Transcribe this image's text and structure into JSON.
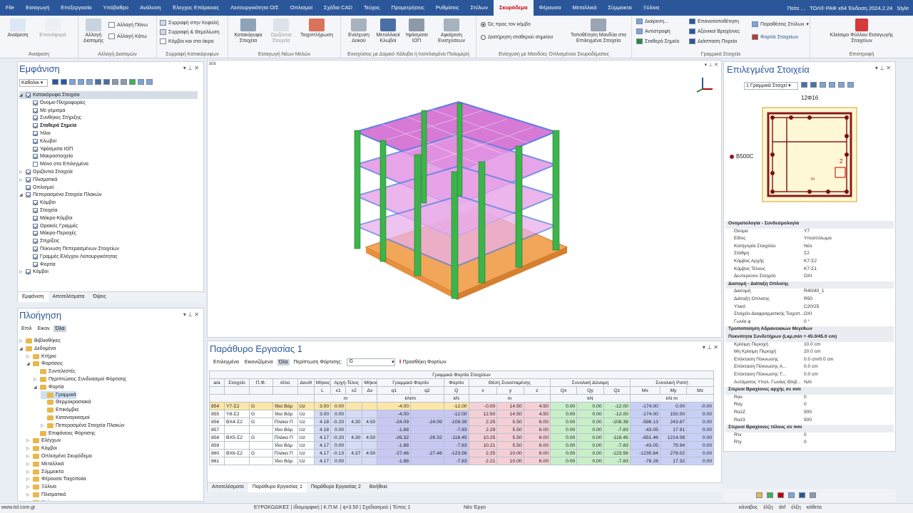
{
  "app": {
    "title": "ΤΟΛ® ΡΑΦ x64 Έκδοση 2024.2.24",
    "style_label": "Style",
    "search": "Πείτε ...",
    "colors": {
      "accent": "#2b579a",
      "active_tab": "#c00000"
    }
  },
  "ribbon_tabs": [
    "File",
    "Εισαγωγή",
    "Επεξεργασία",
    "Υπόβαθρο",
    "Ανάλυση",
    "Έλεγχος Επάρκειας",
    "Λειτουργικότητα Ο/Σ",
    "Οπλισμοί",
    "Σχέδια CAD",
    "Τεύχος",
    "Προμετρήσεις",
    "Ρυθμίσεις",
    "Στύλων",
    "Σκυρόδεμα",
    "Φέρουσα",
    "Μεταλλικά",
    "Σύμμεικτα",
    "Ξύλινα"
  ],
  "active_tab": "Σκυρόδεμα",
  "ribbon": {
    "g1": {
      "label": "Αναίρεση",
      "b1": "Αναίρεση",
      "b2": "Επανάφορά"
    },
    "g2": {
      "label": "Αλλαγή Διατομών",
      "b1": "Αλλαγή Διατομής",
      "s1": "Αλλαγή Πάνω",
      "s2": "Αλλαγή Κάτω"
    },
    "g3": {
      "label": "Συρραφή Κατακόρυφων",
      "s1": "Συρραφή στην Κεφαλή",
      "s2": "Συρραφή & Θεμελίωση",
      "s3": "Κόμβοι και στα άκρα"
    },
    "g4": {
      "label": "Εισαγωγή Νέων Μελών",
      "b1": "Κατακόρυφα Στοιχεία",
      "b2": "Οριζόντια Στοιχεία",
      "b3": "Τοιχοπλήρωση"
    },
    "g5": {
      "label": "Ενισχύσεις με Δομικό Χάλυβα ή Ινοπλισμένα Πολυμερή",
      "b1": "Ενίσχυση Δοκού",
      "b2": "Μεταλλικοί Κλωβοί",
      "b3": "Υφάσματα ΙΟΠ",
      "b4": "Αφαίρεση Ενισχύσεων"
    },
    "g6": {
      "label": "Ενίσχυση με Μανδύες Οπλισμένου Σκυροδέματος",
      "r1": "Ώς προς τον κόμβο",
      "r2": "Διατήρηση σταθερού σημείου",
      "b1": "Τοποθέτηση Μανδύα στα Επιλεγμένα Στοιχεία"
    },
    "g7": {
      "label": "Γραμμικά Στοιχεία",
      "s1": "Διαίρεση...",
      "s2": "Αντιστροφή",
      "s3": "Σταθερό Σημείο",
      "s4": "Επανατοποθέτηση",
      "s5": "Αξονικοί Βραχίονες",
      "s6": "Διάσπαση Πορεία",
      "s7": "Παραθέσεις Στύλων",
      "s8": "Φορτία Στοιχείων"
    },
    "g8": {
      "label": "Επιστροφή",
      "b1": "Κλείσιμο Φύλλου Εισαγωγής Στοιχείων"
    }
  },
  "left_top": {
    "title": "Εμφάνιση",
    "filter": "Καθολικ",
    "items": [
      {
        "label": "Κατακόρυφα Στοιχεία",
        "lvl": 0,
        "tri": "◢",
        "hl": true
      },
      {
        "label": "Όνομα-Πληροφορίες",
        "lvl": 1
      },
      {
        "label": "Με γέμισμα",
        "lvl": 1
      },
      {
        "label": "Συνθήκες Στήριξης",
        "lvl": 1
      },
      {
        "label": "Σταθερά Σημεία",
        "lvl": 1,
        "bold": true
      },
      {
        "label": "Ήλοι",
        "lvl": 1
      },
      {
        "label": "Κλωβοί",
        "lvl": 1
      },
      {
        "label": "Υφάσματα ΙΟΠ",
        "lvl": 1
      },
      {
        "label": "Μακροστοιχεία",
        "lvl": 1
      },
      {
        "label": "Μόνο στα Επιλεγμένα",
        "lvl": 1,
        "nochk": true
      },
      {
        "label": "Οριζόντια Στοιχεία",
        "lvl": 0,
        "tri": "▷"
      },
      {
        "label": "Πλισματικά",
        "lvl": 0,
        "tri": "▷"
      },
      {
        "label": "Οπλισμοί",
        "lvl": 0
      },
      {
        "label": "Πεπερασμένα Στοιχεία Πλακών",
        "lvl": 0,
        "tri": "◢"
      },
      {
        "label": "Κόμβοι",
        "lvl": 1
      },
      {
        "label": "Στοιχεία",
        "lvl": 1
      },
      {
        "label": "Μάκρο-Κόμβοι",
        "lvl": 1
      },
      {
        "label": "Οριακές Γραμμές",
        "lvl": 1
      },
      {
        "label": "Μάκρο-Περιοχές",
        "lvl": 1
      },
      {
        "label": "Στηρίξεις",
        "lvl": 1
      },
      {
        "label": "Πύκνωση Πεπερασμένων Στοιχείων",
        "lvl": 1
      },
      {
        "label": "Γραμμές Ελέγχου Λειτουργικότητας",
        "lvl": 1
      },
      {
        "label": "Φορτία",
        "lvl": 1
      },
      {
        "label": "Κόμβοι",
        "lvl": 0,
        "tri": "▷"
      }
    ],
    "tabs": [
      "Εμφάνιση",
      "Αποτελέσματα",
      "Όψεις"
    ]
  },
  "left_bottom": {
    "title": "Πλοήγηση",
    "filters": [
      "Επιλ",
      "Εικον",
      "Όλα"
    ],
    "items": [
      {
        "label": "Βιβλιοθήκες",
        "lvl": 0,
        "tri": "▷"
      },
      {
        "label": "Δεδομένα",
        "lvl": 0,
        "tri": "◢"
      },
      {
        "label": "Κτήριο",
        "lvl": 1,
        "tri": "▷"
      },
      {
        "label": "Φορτίσεις",
        "lvl": 1,
        "tri": "◢"
      },
      {
        "label": "Συντελεστές",
        "lvl": 2
      },
      {
        "label": "Περιπτώσεις Συνδυασμοί Φόρτισης",
        "lvl": 2,
        "tri": "▷"
      },
      {
        "label": "Φορτία",
        "lvl": 2,
        "tri": "◢"
      },
      {
        "label": "Γραμμικά",
        "lvl": 3,
        "sel": true
      },
      {
        "label": "Θερμοκρασιακά",
        "lvl": 3
      },
      {
        "label": "Επικόμβια",
        "lvl": 3
      },
      {
        "label": "Καταναγκασμοί",
        "lvl": 3
      },
      {
        "label": "Πεπερασμένα Στοιχεία Πλακών",
        "lvl": 3,
        "tri": "▷"
      },
      {
        "label": "Επιφάνειες Φόρτισης",
        "lvl": 2
      },
      {
        "label": "Ελέγχων",
        "lvl": 1,
        "tri": "▷"
      },
      {
        "label": "Κόμβοι",
        "lvl": 1,
        "tri": "▷"
      },
      {
        "label": "Οπλισμένο Σκυρόδεμα",
        "lvl": 1,
        "tri": "▷"
      },
      {
        "label": "Μεταλλικά",
        "lvl": 1,
        "tri": "▷"
      },
      {
        "label": "Σύμμεικτα",
        "lvl": 1,
        "tri": "▷"
      },
      {
        "label": "Φέρουσα Τοιχοποιία",
        "lvl": 1,
        "tri": "▷"
      },
      {
        "label": "Ξύλινα",
        "lvl": 1,
        "tri": "▷"
      },
      {
        "label": "Πλισματικά",
        "lvl": 1,
        "tri": "▷"
      },
      {
        "label": "Κτήριο",
        "lvl": 1,
        "tri": "▷"
      }
    ]
  },
  "viewport": {
    "label": "a/a"
  },
  "work": {
    "title": "Παράθυρο Εργασίας 1",
    "filters": [
      "Επιλεγμένα",
      "Εικονιζόμενα",
      "Όλα"
    ],
    "case_label": "Περίπτωση Φόρτισης:",
    "case_value": "G",
    "add_load": "Προσθήκη Φορτίων",
    "group_header": "Γραμμικά Φορτία Στοιχείων",
    "h1": [
      "a/a",
      "Στοιχείο",
      "Π.Φ.",
      "Αίτιο",
      "Διευθ",
      "Μήκος",
      "Αρχή-Τέλος",
      "",
      "Μήκος",
      "Γραμμικό Φορτίο",
      "",
      "Φορτίο",
      "Θέση Συνισταμένης",
      "",
      "",
      "Συνολική Δύναμη",
      "",
      "",
      "Συνολική Ροπή",
      "",
      ""
    ],
    "h2": [
      "",
      "",
      "",
      "",
      "",
      "L",
      "x1",
      "x2",
      "Δx",
      "q1",
      "q2",
      "Q",
      "x",
      "y",
      "z",
      "Qx",
      "Qy",
      "Qz",
      "Mx",
      "My",
      "Mz"
    ],
    "h3": [
      "",
      "",
      "",
      "",
      "",
      "m",
      "",
      "",
      "",
      "kN/m",
      "",
      "kN",
      "m",
      "",
      "",
      "kN",
      "",
      "",
      "kN·m",
      "",
      ""
    ],
    "rows": [
      [
        "854",
        "Υ7-Σ2",
        "G",
        "Ίδιο Βάρ",
        "Uz",
        "3.00",
        "0.00",
        "",
        "",
        "-4.00",
        "",
        "-12.00",
        "-0.00",
        "14.50",
        "4.50",
        "0.00",
        "0.00",
        "-12.00",
        "-174.00",
        "0.00",
        "-0.00"
      ],
      [
        "855",
        "Υ8-Σ2",
        "G",
        "Ίδιο Βάρ",
        "Uz",
        "3.00",
        "0.00",
        "",
        "",
        "-4.00",
        "",
        "-12.00",
        "12.50",
        "14.50",
        "4.50",
        "0.00",
        "0.00",
        "-12.00",
        "-174.00",
        "150.00",
        "0.00"
      ],
      [
        "856",
        "ΒΧ4-Σ2",
        "G",
        "Πλάκα Π",
        "Uz",
        "4.18",
        "-0.20",
        "4.30",
        "4.50",
        "-24.09",
        "-24.09",
        "-108.39",
        "2.25",
        "5.50",
        "6.00",
        "0.00",
        "0.00",
        "-108.39",
        "-596.13",
        "243.87",
        "0.00"
      ],
      [
        "857",
        "",
        "",
        "Ίδιο Βάρ",
        "Uz",
        "4.18",
        "0.00",
        "",
        "",
        "-1.88",
        "",
        "-7.83",
        "2.29",
        "5.50",
        "6.00",
        "0.00",
        "0.00",
        "-7.83",
        "-43.05",
        "17.91",
        "0.00"
      ],
      [
        "858",
        "ΒΧ5-Σ2",
        "G",
        "Πλάκα Π",
        "Uz",
        "4.17",
        "-0.20",
        "4.30",
        "4.50",
        "-26.32",
        "-26.32",
        "-118.45",
        "10.25",
        "5.50",
        "6.00",
        "0.00",
        "0.00",
        "-118.45",
        "-651.46",
        "1214.08",
        "0.00"
      ],
      [
        "859",
        "",
        "",
        "Ίδιο Βάρ",
        "Uz",
        "4.17",
        "0.00",
        "",
        "",
        "-1.88",
        "",
        "-7.83",
        "10.21",
        "5.50",
        "6.00",
        "0.00",
        "0.00",
        "-7.83",
        "-43.05",
        "79.94",
        "0.00"
      ],
      [
        "860",
        "ΒΧ6-Σ2",
        "G",
        "Πλάκα Π",
        "Uz",
        "4.17",
        "-0.13",
        "4.37",
        "4.50",
        "-27.46",
        "-27.46",
        "-123.56",
        "2.25",
        "10.00",
        "6.00",
        "0.00",
        "0.00",
        "-123.56",
        "-1235.64",
        "278.02",
        "0.00"
      ],
      [
        "861",
        "",
        "",
        "Ίδιο Βάρ",
        "Uz",
        "4.17",
        "0.00",
        "",
        "",
        "-1.88",
        "",
        "-7.83",
        "2.21",
        "10.00",
        "6.00",
        "0.00",
        "0.00",
        "-7.83",
        "-78.28",
        "17.32",
        "0.00"
      ]
    ],
    "bottom_tabs": [
      "Αποτελέσματα",
      "Παράθυρο Εργασίας 1",
      "Παράθυρο Εργασίας 2",
      "Βοήθεια"
    ]
  },
  "right": {
    "title": "Επιλεγμένα Στοιχεία",
    "selector": "1 Γραμμικά Στοιχεί",
    "sec_label": "12Φ16",
    "mat_label": "B500C",
    "num_2": "2",
    "num_m": "m",
    "props": [
      {
        "s": "Ονοματολογία - Συνδεσμολογία"
      },
      {
        "k": "Όνομα",
        "v": "Υ7"
      },
      {
        "k": "Είδος",
        "v": "Υποστύλωμα"
      },
      {
        "k": "Κατηγορία Στοιχείου",
        "v": "Νέο"
      },
      {
        "k": "Στάθμη",
        "v": "Σ2"
      },
      {
        "k": "Κόμβος Αρχής",
        "v": "Κ7-Σ2"
      },
      {
        "k": "Κόμβος Τέλους",
        "v": "Κ7-Σ1"
      },
      {
        "k": "Δευτερεύον Στοιχείο",
        "v": "ΟΧΙ"
      },
      {
        "s": "Διατομή - Διάταξη Οπλισης"
      },
      {
        "k": "Διατομή",
        "v": "R40/40_1"
      },
      {
        "k": "Διάταξη Οπλισης",
        "v": "R50"
      },
      {
        "k": "Υλικό",
        "v": "C20/25"
      },
      {
        "k": "Στοιχείο Διαφραγματικής Τοιχοπ...",
        "v": "ΟΧΙ"
      },
      {
        "k": "Γωνία φ",
        "v": "0 °"
      },
      {
        "s": "Τροποποίηση Αδρανειακών Μεγεθών"
      },
      {
        "s": "Πυκνότητα Συνδετήρων (Lκρ,min = 45.0/45.0 cm)"
      },
      {
        "k": "Κρίσιμη Περιοχή",
        "v": "10.0 cm"
      },
      {
        "k": "Μη Κρίσιμη Περιοχή",
        "v": "20.0 cm"
      },
      {
        "k": "Επέκταση Πύκνωσης",
        "v": "0.0 cm/0.0 cm"
      },
      {
        "k": "Επέκταση Πύκνωσης Α...",
        "v": "0.0 cm"
      },
      {
        "k": "Επέκταση Πύκνωσης Τ...",
        "v": "0.0 cm"
      },
      {
        "k": "Αυτόματος Υπολ. Γωνίας Θλιβ...",
        "v": "ΝΑΙ"
      },
      {
        "s": "Στερεοί Βραχίονες αρχής σε mm"
      },
      {
        "k": "Rαx",
        "v": "0"
      },
      {
        "k": "Rαy",
        "v": "0"
      },
      {
        "k": "RαzZ",
        "v": "500"
      },
      {
        "k": "Rαz3",
        "v": "500"
      },
      {
        "s": "Στερεοί Βραχίονες τέλους σε mm"
      },
      {
        "k": "Rτx",
        "v": "0"
      },
      {
        "k": "Rτy",
        "v": "0"
      }
    ]
  },
  "status": {
    "url": "www.tol.com.gr",
    "code": "ΕΥΡΩΚΩΔΙΚΕΣ | Ιδιομορφική | Κ.Π.Μ. | q=3.50 | Σχεδιασμού | Τύπος 1",
    "project": "Νέο Έργο",
    "snap": [
      "κάναβος",
      "έλξη",
      "dxf",
      "έλξη",
      "κάθετα"
    ]
  }
}
